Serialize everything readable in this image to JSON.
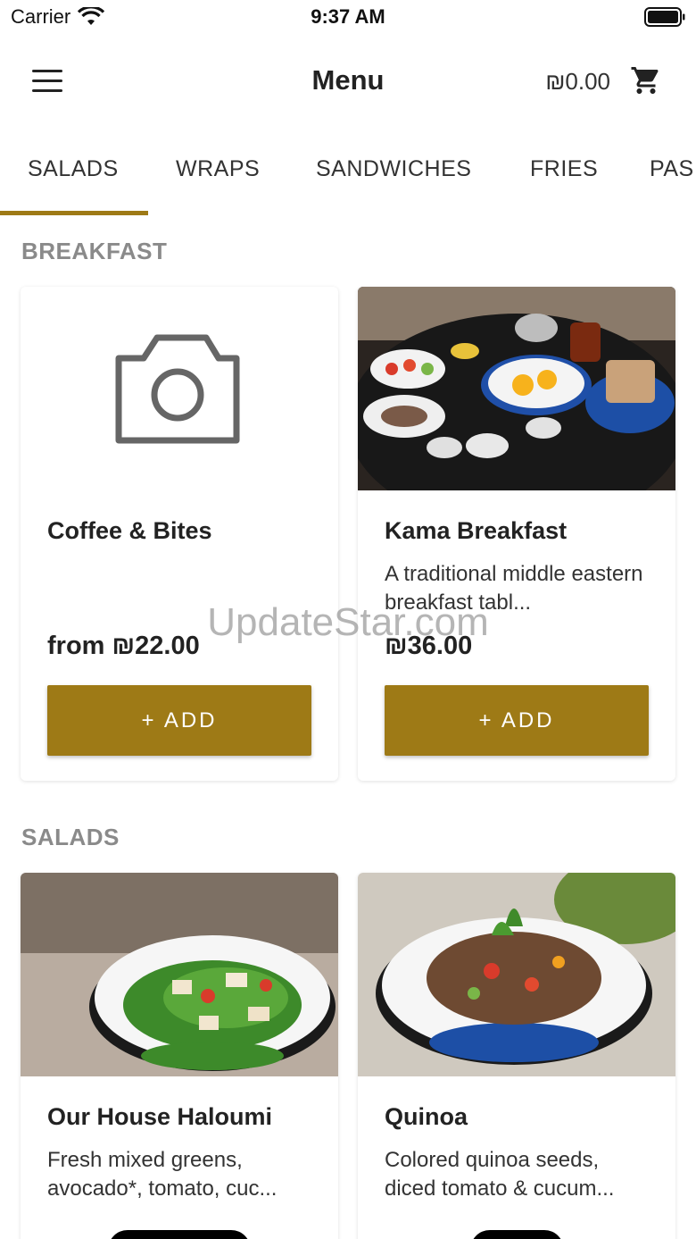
{
  "status_bar": {
    "carrier": "Carrier",
    "time": "9:37 AM"
  },
  "header": {
    "title": "Menu",
    "cart_total": "₪0.00",
    "menu_icon": "hamburger-menu-icon",
    "cart_icon": "shopping-cart-icon"
  },
  "tabs": [
    {
      "label": "SALADS",
      "active": true
    },
    {
      "label": "WRAPS",
      "active": false
    },
    {
      "label": "SANDWICHES",
      "active": false
    },
    {
      "label": "FRIES",
      "active": false
    },
    {
      "label": "PAS",
      "active": false
    }
  ],
  "accent_color": "#9e7a16",
  "sections": [
    {
      "title": "BREAKFAST",
      "items": [
        {
          "name": "Coffee & Bites",
          "description": "",
          "price": "from ₪22.00",
          "add_label": "+ ADD",
          "image": "camera-placeholder-icon"
        },
        {
          "name": "Kama Breakfast",
          "description": "A traditional middle eastern breakfast tabl...",
          "price": "₪36.00",
          "add_label": "+ ADD",
          "image": "breakfast-table-photo"
        }
      ]
    },
    {
      "title": "SALADS",
      "items": [
        {
          "name": "Our House Haloumi",
          "description": "Fresh mixed greens, avocado*, tomato, cuc...",
          "image": "haloumi-salad-photo"
        },
        {
          "name": "Quinoa",
          "description": "Colored quinoa seeds, diced tomato & cucum...",
          "image": "quinoa-salad-photo"
        }
      ]
    }
  ],
  "watermark": "UpdateStar.com"
}
